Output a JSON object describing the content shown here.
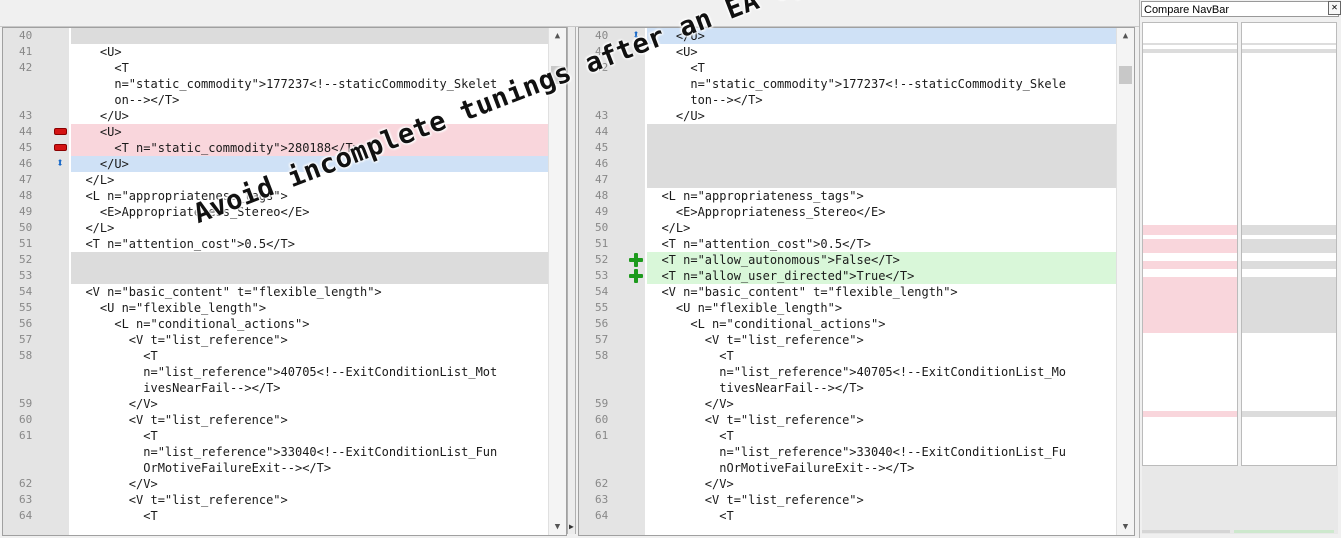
{
  "navbar": {
    "title": "Compare NavBar",
    "close_glyph": "✕"
  },
  "watermark": "Avoid incomplete tunings after an EA update",
  "colors": {
    "deleted": "#f9d6dc",
    "changed": "#cfe1f6",
    "added": "#d9f7d9",
    "blank": "#dcdcdc"
  },
  "left": {
    "rows": [
      {
        "ln": "40",
        "code": "",
        "state": "blank",
        "mark": ""
      },
      {
        "ln": "41",
        "code": "    <U>",
        "state": "",
        "mark": ""
      },
      {
        "ln": "42",
        "code": "      <T",
        "state": "",
        "mark": ""
      },
      {
        "ln": "",
        "code": "      n=\"static_commodity\">177237<!--staticCommodity_Skelet",
        "state": "",
        "mark": ""
      },
      {
        "ln": "",
        "code": "      on--></T>",
        "state": "",
        "mark": ""
      },
      {
        "ln": "43",
        "code": "    </U>",
        "state": "",
        "mark": ""
      },
      {
        "ln": "44",
        "code": "    <U>",
        "state": "deleted",
        "mark": "minus-icon"
      },
      {
        "ln": "45",
        "code": "      <T n=\"static_commodity\">280188</T>",
        "state": "deleted",
        "mark": "minus-icon"
      },
      {
        "ln": "46",
        "code": "    </U>",
        "state": "changed",
        "mark": "arrows-icon"
      },
      {
        "ln": "47",
        "code": "  </L>",
        "state": "",
        "mark": ""
      },
      {
        "ln": "48",
        "code": "  <L n=\"appropriateness_tags\">",
        "state": "",
        "mark": ""
      },
      {
        "ln": "49",
        "code": "    <E>Appropriateness_Stereo</E>",
        "state": "",
        "mark": ""
      },
      {
        "ln": "50",
        "code": "  </L>",
        "state": "",
        "mark": ""
      },
      {
        "ln": "51",
        "code": "  <T n=\"attention_cost\">0.5</T>",
        "state": "",
        "mark": ""
      },
      {
        "ln": "52",
        "code": "",
        "state": "blank",
        "mark": ""
      },
      {
        "ln": "53",
        "code": "",
        "state": "blank",
        "mark": ""
      },
      {
        "ln": "54",
        "code": "  <V n=\"basic_content\" t=\"flexible_length\">",
        "state": "",
        "mark": ""
      },
      {
        "ln": "55",
        "code": "    <U n=\"flexible_length\">",
        "state": "",
        "mark": ""
      },
      {
        "ln": "56",
        "code": "      <L n=\"conditional_actions\">",
        "state": "",
        "mark": ""
      },
      {
        "ln": "57",
        "code": "        <V t=\"list_reference\">",
        "state": "",
        "mark": ""
      },
      {
        "ln": "58",
        "code": "          <T",
        "state": "",
        "mark": ""
      },
      {
        "ln": "",
        "code": "          n=\"list_reference\">40705<!--ExitConditionList_Mot",
        "state": "",
        "mark": ""
      },
      {
        "ln": "",
        "code": "          ivesNearFail--></T>",
        "state": "",
        "mark": ""
      },
      {
        "ln": "59",
        "code": "        </V>",
        "state": "",
        "mark": ""
      },
      {
        "ln": "60",
        "code": "        <V t=\"list_reference\">",
        "state": "",
        "mark": ""
      },
      {
        "ln": "61",
        "code": "          <T",
        "state": "",
        "mark": ""
      },
      {
        "ln": "",
        "code": "          n=\"list_reference\">33040<!--ExitConditionList_Fun",
        "state": "",
        "mark": ""
      },
      {
        "ln": "",
        "code": "          OrMotiveFailureExit--></T>",
        "state": "",
        "mark": ""
      },
      {
        "ln": "62",
        "code": "        </V>",
        "state": "",
        "mark": ""
      },
      {
        "ln": "63",
        "code": "        <V t=\"list_reference\">",
        "state": "",
        "mark": ""
      },
      {
        "ln": "64",
        "code": "          <T",
        "state": "",
        "mark": ""
      }
    ]
  },
  "right": {
    "rows": [
      {
        "ln": "40",
        "code": "    </U>",
        "state": "changed",
        "mark": "arrows-icon"
      },
      {
        "ln": "41",
        "code": "    <U>",
        "state": "",
        "mark": ""
      },
      {
        "ln": "42",
        "code": "      <T",
        "state": "",
        "mark": ""
      },
      {
        "ln": "",
        "code": "      n=\"static_commodity\">177237<!--staticCommodity_Skele",
        "state": "",
        "mark": ""
      },
      {
        "ln": "",
        "code": "      ton--></T>",
        "state": "",
        "mark": ""
      },
      {
        "ln": "43",
        "code": "    </U>",
        "state": "",
        "mark": ""
      },
      {
        "ln": "44",
        "code": "",
        "state": "blank",
        "mark": ""
      },
      {
        "ln": "45",
        "code": "",
        "state": "blank",
        "mark": ""
      },
      {
        "ln": "46",
        "code": "",
        "state": "blank",
        "mark": ""
      },
      {
        "ln": "47",
        "code": "",
        "state": "blank",
        "mark": ""
      },
      {
        "ln": "48",
        "code": "  <L n=\"appropriateness_tags\">",
        "state": "",
        "mark": ""
      },
      {
        "ln": "49",
        "code": "    <E>Appropriateness_Stereo</E>",
        "state": "",
        "mark": ""
      },
      {
        "ln": "50",
        "code": "  </L>",
        "state": "",
        "mark": ""
      },
      {
        "ln": "51",
        "code": "  <T n=\"attention_cost\">0.5</T>",
        "state": "",
        "mark": ""
      },
      {
        "ln": "52",
        "code": "  <T n=\"allow_autonomous\">False</T>",
        "state": "added",
        "mark": "plus-icon"
      },
      {
        "ln": "53",
        "code": "  <T n=\"allow_user_directed\">True</T>",
        "state": "added",
        "mark": "plus-icon"
      },
      {
        "ln": "54",
        "code": "  <V n=\"basic_content\" t=\"flexible_length\">",
        "state": "",
        "mark": ""
      },
      {
        "ln": "55",
        "code": "    <U n=\"flexible_length\">",
        "state": "",
        "mark": ""
      },
      {
        "ln": "56",
        "code": "      <L n=\"conditional_actions\">",
        "state": "",
        "mark": ""
      },
      {
        "ln": "57",
        "code": "        <V t=\"list_reference\">",
        "state": "",
        "mark": ""
      },
      {
        "ln": "58",
        "code": "          <T",
        "state": "",
        "mark": ""
      },
      {
        "ln": "",
        "code": "          n=\"list_reference\">40705<!--ExitConditionList_Mo",
        "state": "",
        "mark": ""
      },
      {
        "ln": "",
        "code": "          tivesNearFail--></T>",
        "state": "",
        "mark": ""
      },
      {
        "ln": "59",
        "code": "        </V>",
        "state": "",
        "mark": ""
      },
      {
        "ln": "60",
        "code": "        <V t=\"list_reference\">",
        "state": "",
        "mark": ""
      },
      {
        "ln": "61",
        "code": "          <T",
        "state": "",
        "mark": ""
      },
      {
        "ln": "",
        "code": "          n=\"list_reference\">33040<!--ExitConditionList_Fu",
        "state": "",
        "mark": ""
      },
      {
        "ln": "",
        "code": "          nOrMotiveFailureExit--></T>",
        "state": "",
        "mark": ""
      },
      {
        "ln": "62",
        "code": "        </V>",
        "state": "",
        "mark": ""
      },
      {
        "ln": "63",
        "code": "        <V t=\"list_reference\">",
        "state": "",
        "mark": ""
      },
      {
        "ln": "64",
        "code": "          <T",
        "state": "",
        "mark": ""
      }
    ]
  }
}
